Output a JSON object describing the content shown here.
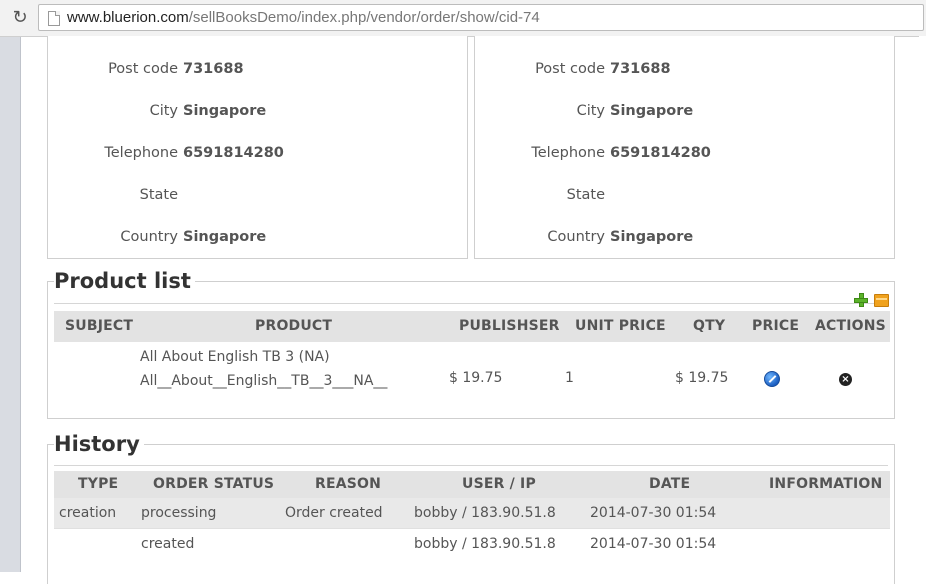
{
  "browser": {
    "url_host": "www.bluerion.com",
    "url_path": "/sellBooksDemo/index.php/vendor/order/show/cid-74",
    "reload_glyph": "↻"
  },
  "billing_address": {
    "postcode_label": "Post code",
    "postcode": "731688",
    "city_label": "City",
    "city": "Singapore",
    "telephone_label": "Telephone",
    "telephone": "6591814280",
    "state_label": "State",
    "state": "",
    "country_label": "Country",
    "country": "Singapore"
  },
  "shipping_address": {
    "postcode_label": "Post code",
    "postcode": "731688",
    "city_label": "City",
    "city": "Singapore",
    "telephone_label": "Telephone",
    "telephone": "6591814280",
    "state_label": "State",
    "state": "",
    "country_label": "Country",
    "country": "Singapore"
  },
  "product_list": {
    "title": "Product list",
    "headers": [
      "SUBJECT",
      "PRODUCT",
      "PUBLISHSER",
      "UNIT PRICE",
      "QTY",
      "PRICE",
      "ACTIONS"
    ],
    "rows": [
      {
        "subject": "",
        "product_name": "All About English TB 3 (NA)",
        "product_slug": "All__About__English__TB__3___NA__",
        "publisher": "$ 19.75",
        "unit_price": "1",
        "qty": "$ 19.75",
        "price_icon": "edit-icon",
        "action_icon": "delete-icon"
      }
    ],
    "toolbar_icons": [
      "add-icon",
      "folder-icon"
    ]
  },
  "history": {
    "title": "History",
    "headers": [
      "TYPE",
      "ORDER STATUS",
      "REASON",
      "USER / IP",
      "DATE",
      "INFORMATION"
    ],
    "rows": [
      {
        "type": "creation",
        "order_status": "processing",
        "reason": "Order created",
        "user_ip": "bobby / 183.90.51.8",
        "date": "2014-07-30 01:54",
        "information": ""
      },
      {
        "type": "",
        "order_status": "created",
        "reason": "",
        "user_ip": "bobby / 183.90.51.8",
        "date": "2014-07-30 01:54",
        "information": ""
      }
    ]
  }
}
